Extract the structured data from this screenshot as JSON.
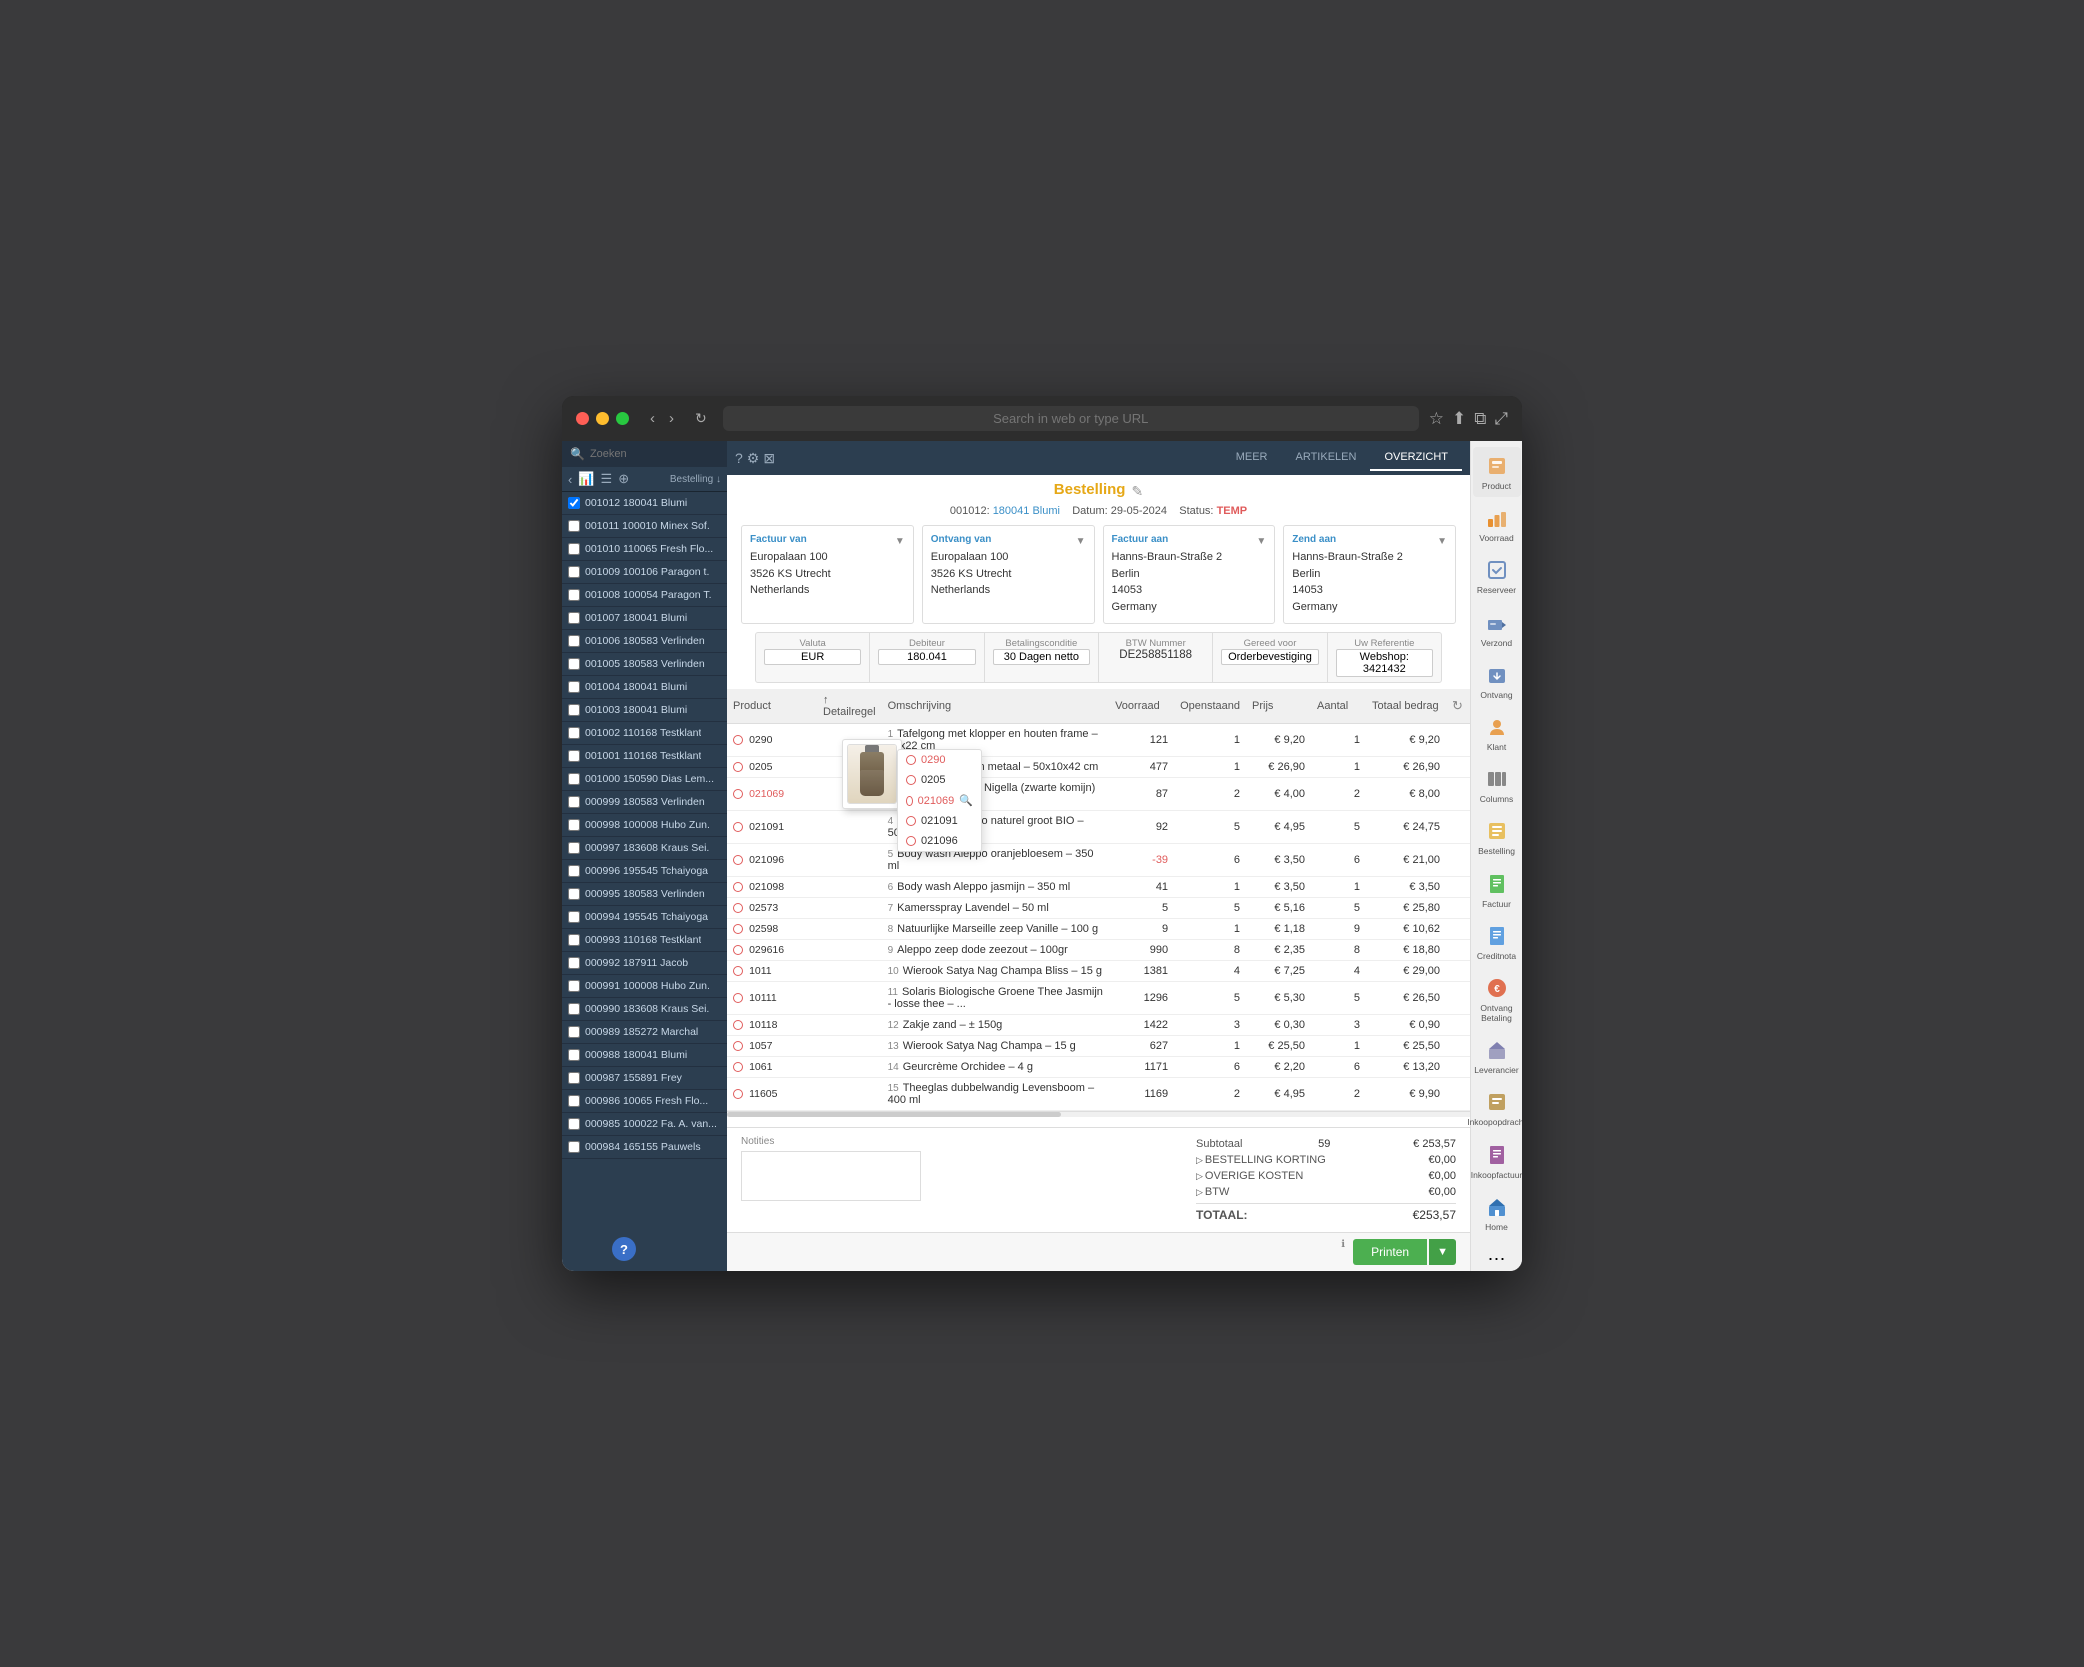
{
  "browser": {
    "address_placeholder": "Search in web or type URL"
  },
  "sidebar": {
    "search_placeholder": "Zoeken",
    "toolbar": {
      "back": "‹",
      "chart": "▐",
      "list": "☰",
      "add": "⊕",
      "sort_label": "Bestelling ↓"
    },
    "orders": [
      {
        "id": "001012",
        "code": "180041",
        "name": "Blumi",
        "active": true
      },
      {
        "id": "001011",
        "code": "100010",
        "name": "Minex Sof."
      },
      {
        "id": "001010",
        "code": "110065",
        "name": "Fresh Flo..."
      },
      {
        "id": "001009",
        "code": "100106",
        "name": "Paragon t."
      },
      {
        "id": "001008",
        "code": "100054",
        "name": "Paragon T."
      },
      {
        "id": "001007",
        "code": "180041",
        "name": "Blumi"
      },
      {
        "id": "001006",
        "code": "180583",
        "name": "Verlinden"
      },
      {
        "id": "001005",
        "code": "180583",
        "name": "Verlinden"
      },
      {
        "id": "001004",
        "code": "180041",
        "name": "Blumi"
      },
      {
        "id": "001003",
        "code": "180041",
        "name": "Blumi"
      },
      {
        "id": "001002",
        "code": "110168",
        "name": "Testklant"
      },
      {
        "id": "001001",
        "code": "110168",
        "name": "Testklant"
      },
      {
        "id": "001000",
        "code": "150590",
        "name": "Dias Lem..."
      },
      {
        "id": "000999",
        "code": "180583",
        "name": "Verlinden"
      },
      {
        "id": "000998",
        "code": "100008",
        "name": "Hubo Zun."
      },
      {
        "id": "000997",
        "code": "183608",
        "name": "Kraus Sei."
      },
      {
        "id": "000996",
        "code": "195545",
        "name": "Tchaiyoga"
      },
      {
        "id": "000995",
        "code": "180583",
        "name": "Verlinden"
      },
      {
        "id": "000994",
        "code": "195545",
        "name": "Tchaiyoga"
      },
      {
        "id": "000993",
        "code": "110168",
        "name": "Testklant"
      },
      {
        "id": "000992",
        "code": "187911",
        "name": "Jacob"
      },
      {
        "id": "000991",
        "code": "100008",
        "name": "Hubo Zun."
      },
      {
        "id": "000990",
        "code": "183608",
        "name": "Kraus Sei."
      },
      {
        "id": "000989",
        "code": "185272",
        "name": "Marchal"
      },
      {
        "id": "000988",
        "code": "180041",
        "name": "Blumi"
      },
      {
        "id": "000987",
        "code": "155891",
        "name": "Frey"
      },
      {
        "id": "000986",
        "code": "110065",
        "name": "Fresh Flo..."
      },
      {
        "id": "000985",
        "code": "100022",
        "name": "Fa. A. van..."
      },
      {
        "id": "000984",
        "code": "165155",
        "name": "Pauwels"
      }
    ]
  },
  "tabs": {
    "meer": "MEER",
    "artikelen": "ARTIKELEN",
    "overzicht": "OVERZICHT"
  },
  "order": {
    "title": "Bestelling",
    "order_number": "001012:",
    "order_ref": "180041 Blumi",
    "datum_label": "Datum:",
    "datum": "29-05-2024",
    "status_label": "Status:",
    "status": "TEMP",
    "edit_icon": "✎"
  },
  "factuur_van": {
    "title": "Factuur van",
    "line1": "Europalaan 100",
    "line2": "3526 KS Utrecht",
    "line3": "Netherlands"
  },
  "ontvang_van": {
    "title": "Ontvang van",
    "line1": "Europalaan 100",
    "line2": "3526 KS Utrecht",
    "line3": "Netherlands"
  },
  "factuur_aan": {
    "title": "Factuur aan",
    "line1": "Hanns-Braun-Straße 2",
    "line2": "Berlin",
    "line3": "14053",
    "line4": "Germany"
  },
  "zend_aan": {
    "title": "Zend aan",
    "line1": "Hanns-Braun-Straße 2",
    "line2": "Berlin",
    "line3": "14053",
    "line4": "Germany"
  },
  "financial": {
    "valuta_label": "Valuta",
    "valuta": "EUR",
    "debiteur_label": "Debiteur",
    "debiteur": "180.041",
    "betalingsconditie_label": "Betalingsconditie",
    "betalingsconditie": "30 Dagen netto",
    "btw_label": "BTW Nummer",
    "btw": "DE258851188",
    "gereed_label": "Gereed voor",
    "gereed": "Orderbevestiging",
    "referentie_label": "Uw Referentie",
    "referentie": "Webshop: 3421432"
  },
  "table": {
    "headers": {
      "product": "Product",
      "detailregel": "↑ Detailregel",
      "omschrijving": "Omschrijving",
      "voorraad": "Voorraad",
      "openstaand": "Openstaand",
      "prijs": "Prijs",
      "aantal": "Aantal",
      "totaal": "Totaal bedrag"
    },
    "rows": [
      {
        "nr": 1,
        "product": "0290",
        "omschrijving": "Tafelgong met klopper en houten frame – 24x22 cm",
        "voorraad": 121,
        "openstaand": 1,
        "prijs": "€ 9,20",
        "aantal": 1,
        "totaal": "€ 9,20"
      },
      {
        "nr": 2,
        "product": "0205",
        "omschrijving": "Tafelgong hout en metaal – 50x10x42 cm",
        "voorraad": 477,
        "openstaand": 1,
        "prijs": "€ 26,90",
        "aantal": 1,
        "totaal": "€ 26,90"
      },
      {
        "nr": 3,
        "product": "021069",
        "omschrijving": "Shampoo Aleppo Nigella (zwarte komijn) – 350 ml",
        "voorraad": 87,
        "openstaand": 2,
        "prijs": "€ 4,00",
        "aantal": 2,
        "totaal": "€ 8,00",
        "has_image": true,
        "link": true
      },
      {
        "nr": 4,
        "product": "021091",
        "omschrijving": "Body wash Aleppo naturel groot BIO – 500 ml",
        "voorraad": 92,
        "openstaand": 5,
        "prijs": "€ 4,95",
        "aantal": 5,
        "totaal": "€ 24,75"
      },
      {
        "nr": 5,
        "product": "021096",
        "omschrijving": "Body wash Aleppo oranjebloesem – 350 ml",
        "voorraad": -39,
        "openstaand": 6,
        "prijs": "€ 3,50",
        "aantal": 6,
        "totaal": "€ 21,00"
      },
      {
        "nr": 6,
        "product": "021098",
        "omschrijving": "Body wash Aleppo jasmijn – 350 ml",
        "voorraad": 41,
        "openstaand": 1,
        "prijs": "€ 3,50",
        "aantal": 1,
        "totaal": "€ 3,50"
      },
      {
        "nr": 7,
        "product": "02573",
        "omschrijving": "Kamersspray Lavendel – 50 ml",
        "voorraad": 5,
        "openstaand": 5,
        "prijs": "€ 5,16",
        "aantal": 5,
        "totaal": "€ 25,80"
      },
      {
        "nr": 8,
        "product": "02598",
        "omschrijving": "Natuurlijke Marseille zeep Vanille – 100 g",
        "voorraad": 9,
        "openstaand": 1,
        "prijs": "€ 1,18",
        "aantal": 9,
        "totaal": "€ 10,62"
      },
      {
        "nr": 9,
        "product": "029616",
        "omschrijving": "Aleppo zeep dode zeezout – 100gr",
        "voorraad": 990,
        "openstaand": 8,
        "prijs": "€ 2,35",
        "aantal": 8,
        "totaal": "€ 18,80"
      },
      {
        "nr": 10,
        "product": "1011",
        "omschrijving": "Wierook Satya Nag Champa Bliss – 15 g",
        "voorraad": 1381,
        "openstaand": 4,
        "prijs": "€ 7,25",
        "aantal": 4,
        "totaal": "€ 29,00"
      },
      {
        "nr": 11,
        "product": "10111",
        "omschrijving": "Solaris Biologische Groene Thee Jasmijn - losse thee – ...",
        "voorraad": 1296,
        "openstaand": 5,
        "prijs": "€ 5,30",
        "aantal": 5,
        "totaal": "€ 26,50"
      },
      {
        "nr": 12,
        "product": "10118",
        "omschrijving": "Zakje zand – ± 150g",
        "voorraad": 1422,
        "openstaand": 3,
        "prijs": "€ 0,30",
        "aantal": 3,
        "totaal": "€ 0,90"
      },
      {
        "nr": 13,
        "product": "1057",
        "omschrijving": "Wierook Satya Nag Champa – 15 g",
        "voorraad": 627,
        "openstaand": 1,
        "prijs": "€ 25,50",
        "aantal": 1,
        "totaal": "€ 25,50"
      },
      {
        "nr": 14,
        "product": "1061",
        "omschrijving": "Geurcrème Orchidee – 4 g",
        "voorraad": 1171,
        "openstaand": 6,
        "prijs": "€ 2,20",
        "aantal": 6,
        "totaal": "€ 13,20"
      },
      {
        "nr": 15,
        "product": "11605",
        "omschrijving": "Theeglas dubbelwandig Levensboom – 400 ml",
        "voorraad": 1169,
        "openstaand": 2,
        "prijs": "€ 4,95",
        "aantal": 2,
        "totaal": "€ 9,90"
      }
    ],
    "product_dropdown": [
      "0290",
      "0205",
      "021069",
      "021091",
      "021096"
    ]
  },
  "totals": {
    "subtotaal_label": "Subtotaal",
    "subtotaal_qty": 59,
    "subtotaal_value": "€ 253,57",
    "bestelling_korting_label": "BESTELLING KORTING",
    "bestelling_korting": "€0,00",
    "overige_kosten_label": "OVERIGE KOSTEN",
    "overige_kosten": "€0,00",
    "btw_label": "BTW",
    "btw_value": "€0,00",
    "totaal_label": "TOTAAL:",
    "totaal_value": "€253,57",
    "notities_label": "Notities"
  },
  "print_btn": "Printen",
  "right_sidebar": {
    "items": [
      {
        "icon": "📦",
        "label": "Product",
        "active": true
      },
      {
        "icon": "🏪",
        "label": "Voorraad"
      },
      {
        "icon": "📋",
        "label": "Reserveer"
      },
      {
        "icon": "🚚",
        "label": "Verzond"
      },
      {
        "icon": "📬",
        "label": "Ontvang"
      },
      {
        "icon": "👤",
        "label": "Klant"
      },
      {
        "icon": "≡",
        "label": "Columns"
      },
      {
        "icon": "🛒",
        "label": "Bestelling"
      },
      {
        "icon": "💰",
        "label": "Factuur"
      },
      {
        "icon": "📄",
        "label": "Creditnota"
      },
      {
        "icon": "💳",
        "label": "Ontvang Betaling"
      },
      {
        "icon": "🏭",
        "label": "Leverancier"
      },
      {
        "icon": "📝",
        "label": "Inkoopopdracht"
      },
      {
        "icon": "🧾",
        "label": "Inkoopfactuur"
      },
      {
        "icon": "🏠",
        "label": "Home"
      },
      {
        "icon": "⋯",
        "label": "< Meer"
      }
    ]
  }
}
